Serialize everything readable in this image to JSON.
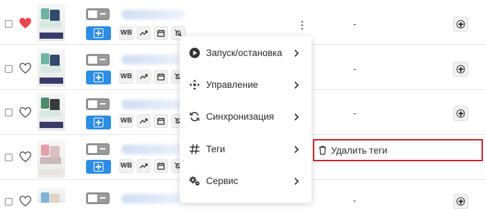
{
  "rows": [
    {
      "dash": "-",
      "favorite": true
    },
    {
      "dash": "-",
      "favorite": false
    },
    {
      "dash": "-",
      "favorite": false
    },
    {
      "dash": "-",
      "favorite": false
    },
    {
      "dash": "-",
      "favorite": false
    }
  ],
  "mini_buttons": {
    "wb_label": "WB"
  },
  "menu": {
    "items": [
      {
        "label": "Запуск/остановка",
        "icon": "play-circle-icon"
      },
      {
        "label": "Управление",
        "icon": "move-arrows-icon"
      },
      {
        "label": "Синхронизация",
        "icon": "sync-icon"
      },
      {
        "label": "Теги",
        "icon": "hashtag-icon"
      },
      {
        "label": "Сервис",
        "icon": "gears-icon"
      }
    ],
    "submenu": {
      "label": "Удалить теги",
      "icon": "trash-icon"
    }
  },
  "colors": {
    "accent": "#2d8de4",
    "favorite": "#e8474d",
    "highlight": "#c8202a"
  }
}
